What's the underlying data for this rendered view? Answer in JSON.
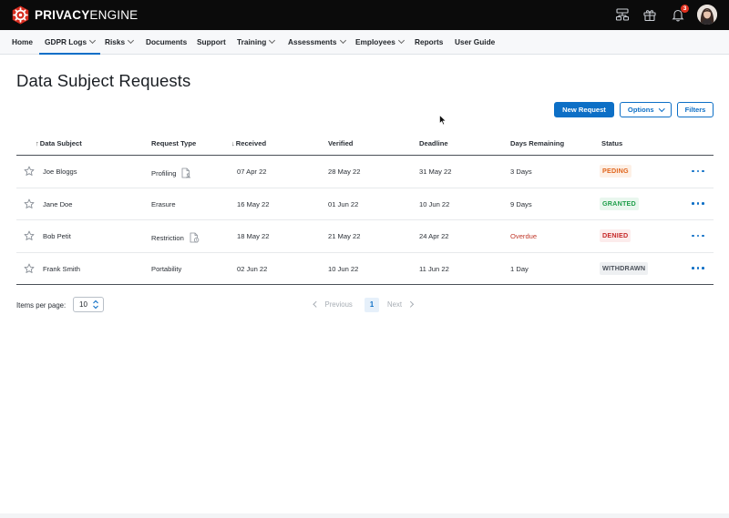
{
  "brand": {
    "name_bold": "PRIVACY",
    "name_rest": "ENGINE",
    "accent": "#d62c1f"
  },
  "topbar": {
    "icons": [
      "sitemap-icon",
      "gift-icon",
      "bell-icon"
    ],
    "notification_count": "3"
  },
  "nav": {
    "items": [
      {
        "label": "Home",
        "dropdown": false
      },
      {
        "label": "GDPR Logs",
        "dropdown": true,
        "active": true
      },
      {
        "label": "Risks",
        "dropdown": true
      },
      {
        "label": "Documents",
        "dropdown": false
      },
      {
        "label": "Support",
        "dropdown": false
      },
      {
        "label": "Training",
        "dropdown": true
      },
      {
        "label": "Assessments",
        "dropdown": true
      },
      {
        "label": "Employees",
        "dropdown": true
      },
      {
        "label": "Reports",
        "dropdown": false
      },
      {
        "label": "User Guide",
        "dropdown": false
      }
    ]
  },
  "page": {
    "title": "Data Subject Requests"
  },
  "actions": {
    "new_request": "New Request",
    "options": "Options",
    "filters": "Filters"
  },
  "table": {
    "columns": {
      "data_subject": "Data Subject",
      "request_type": "Request Type",
      "received": "Received",
      "verified": "Verified",
      "deadline": "Deadline",
      "days_remaining": "Days Remaining",
      "status": "Status"
    },
    "sort_arrows": {
      "data_subject": "↑",
      "received": "↓"
    },
    "rows": [
      {
        "subject": "Joe Bloggs",
        "type": "Profiling",
        "type_icon": "document-person-icon",
        "received": "07 Apr 22",
        "verified": "28 May 22",
        "deadline": "31 May 22",
        "days": "3 Days",
        "days_overdue": false,
        "status": "PEDING"
      },
      {
        "subject": "Jane Doe",
        "type": "Erasure",
        "type_icon": "",
        "received": "16 May 22",
        "verified": "01 Jun 22",
        "deadline": "10 Jun 22",
        "days": "9 Days",
        "days_overdue": false,
        "status": "GRANTED"
      },
      {
        "subject": "Bob Petit",
        "type": "Restriction",
        "type_icon": "document-lock-icon",
        "received": "18 May 22",
        "verified": "21 May 22",
        "deadline": "24 Apr 22",
        "days": "Overdue",
        "days_overdue": true,
        "status": "DENIED"
      },
      {
        "subject": "Frank Smith",
        "type": "Portability",
        "type_icon": "",
        "received": "02 Jun 22",
        "verified": "10 Jun 22",
        "deadline": "11 Jun 22",
        "days": "1 Day",
        "days_overdue": false,
        "status": "WITHDRAWN"
      }
    ],
    "status_colors": {
      "PEDING": {
        "fg": "#e0641b",
        "bg": "#fdf0e6"
      },
      "GRANTED": {
        "fg": "#1e9e4a",
        "bg": "#e9f7ee"
      },
      "DENIED": {
        "fg": "#c62828",
        "bg": "#fcecec"
      },
      "WITHDRAWN": {
        "fg": "#4a5059",
        "bg": "#eef0f2"
      }
    }
  },
  "pagination": {
    "items_per_page_label": "Items per page:",
    "items_per_page": "10",
    "previous": "Previous",
    "current_page": "1",
    "next": "Next"
  }
}
